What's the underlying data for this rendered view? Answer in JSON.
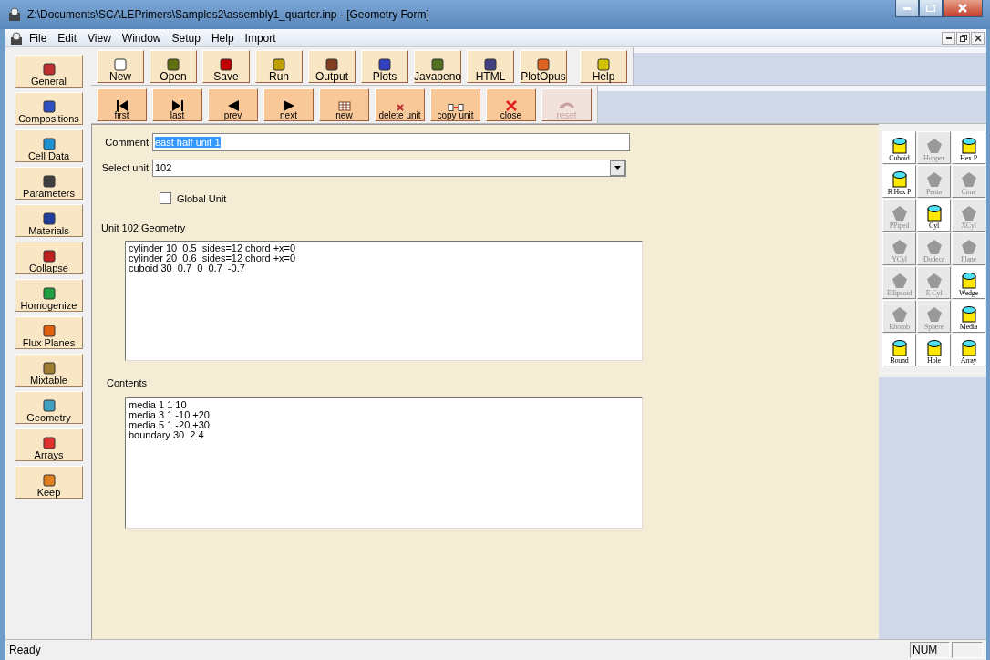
{
  "window": {
    "title": "Z:\\Documents\\SCALEPrimers\\Samples2\\assembly1_quarter.inp - [Geometry Form]"
  },
  "menu": [
    "File",
    "Edit",
    "View",
    "Window",
    "Setup",
    "Help",
    "Import"
  ],
  "sidebar": [
    {
      "label": "General"
    },
    {
      "label": "Compositions"
    },
    {
      "label": "Cell Data"
    },
    {
      "label": "Parameters"
    },
    {
      "label": "Materials"
    },
    {
      "label": "Collapse"
    },
    {
      "label": "Homogenize"
    },
    {
      "label": "Flux Planes"
    },
    {
      "label": "Mixtable"
    },
    {
      "label": "Geometry"
    },
    {
      "label": "Arrays"
    },
    {
      "label": "Keep"
    }
  ],
  "toolbar": [
    {
      "label": "New"
    },
    {
      "label": "Open"
    },
    {
      "label": "Save"
    },
    {
      "label": "Run"
    },
    {
      "label": "Output"
    },
    {
      "label": "Plots"
    },
    {
      "label": "Javapeno"
    },
    {
      "label": "HTML"
    },
    {
      "label": "PlotOpus"
    },
    {
      "label": "Help"
    }
  ],
  "navigation": [
    {
      "label": "first",
      "disabled": false
    },
    {
      "label": "last",
      "disabled": false
    },
    {
      "label": "prev",
      "disabled": false
    },
    {
      "label": "next",
      "disabled": false
    },
    {
      "label": "new",
      "disabled": false
    },
    {
      "label": "delete unit",
      "disabled": false
    },
    {
      "label": "copy unit",
      "disabled": false
    },
    {
      "label": "close",
      "disabled": false
    },
    {
      "label": "reset",
      "disabled": true
    }
  ],
  "form": {
    "comment_label": "Comment",
    "comment": "east half unit 1",
    "comment_selected": true,
    "unit_label": "Select unit",
    "unit": "102",
    "global_label": "Global Unit",
    "global_checked": false,
    "geometry_label": "Unit 102 Geometry",
    "geometry_lines": [
      "cylinder 10  0.5  sides=12 chord +x=0",
      "cylinder 20  0.6  sides=12 chord +x=0",
      "cuboid 30  0.7  0  0.7  -0.7"
    ],
    "contents_label": "Contents",
    "contents_lines": [
      "media 1 1 10",
      "media 3 1 -10 +20",
      "media 5 1 -20 +30",
      "boundary 30  2 4"
    ]
  },
  "shapes": [
    {
      "label": "Cuboid",
      "disabled": false
    },
    {
      "label": "Hopper",
      "disabled": true
    },
    {
      "label": "Hex P",
      "disabled": false
    },
    {
      "label": "R Hex P",
      "disabled": false
    },
    {
      "label": "Penta",
      "disabled": true
    },
    {
      "label": "Cone",
      "disabled": true
    },
    {
      "label": "PPiped",
      "disabled": true
    },
    {
      "label": "Cyl",
      "disabled": false
    },
    {
      "label": "XCyl",
      "disabled": true
    },
    {
      "label": "YCyl",
      "disabled": true
    },
    {
      "label": "Dodeca",
      "disabled": true
    },
    {
      "label": "Plane",
      "disabled": true
    },
    {
      "label": "Ellipsoid",
      "disabled": true
    },
    {
      "label": "E Cyl",
      "disabled": true
    },
    {
      "label": "Wedge",
      "disabled": false
    },
    {
      "label": "Rhomb",
      "disabled": true
    },
    {
      "label": "Sphere",
      "disabled": true
    },
    {
      "label": "Media",
      "disabled": false
    },
    {
      "label": "Bound",
      "disabled": false
    },
    {
      "label": "Hole",
      "disabled": false
    },
    {
      "label": "Array",
      "disabled": false
    }
  ],
  "status_bar": {
    "message": "Ready",
    "indicator": "NUM"
  }
}
